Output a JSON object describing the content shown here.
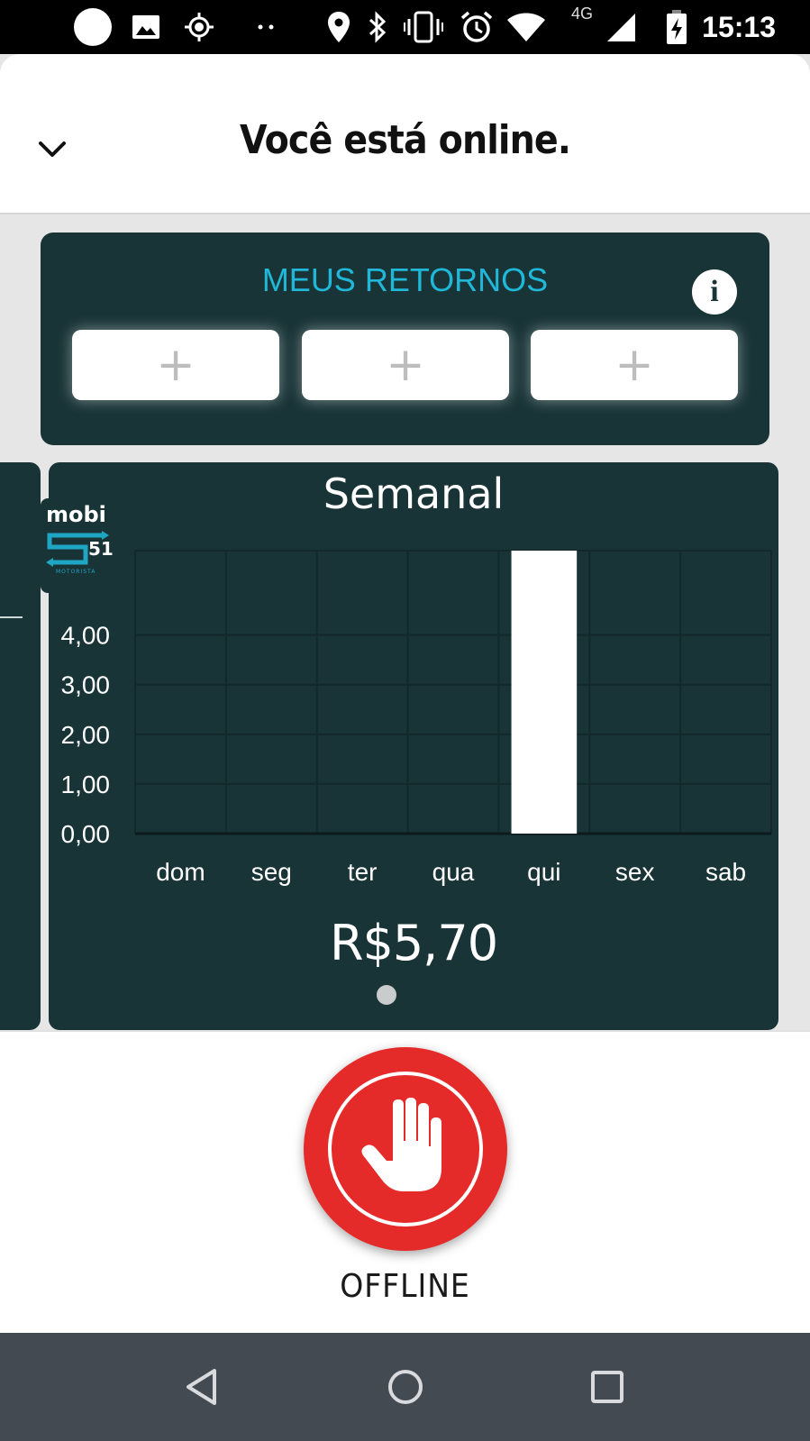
{
  "status_bar": {
    "network": "4G",
    "time": "15:13",
    "icons": [
      "circle-icon",
      "image-icon",
      "gps-icon",
      "more-dots-icon",
      "location-icon",
      "bluetooth-icon",
      "vibrate-icon",
      "alarm-icon",
      "wifi-icon",
      "signal-icon",
      "battery-charging-icon"
    ]
  },
  "header": {
    "title": "Você está online.",
    "collapse_icon": "chevron-down-icon"
  },
  "returns": {
    "title": "MEUS RETORNOS",
    "info_glyph": "i",
    "slots": [
      "+",
      "+",
      "+"
    ]
  },
  "logo": {
    "brand": "mobi",
    "number": "51",
    "subtitle": "MOTORISTA"
  },
  "chart_data": {
    "type": "bar",
    "title": "Semanal",
    "categories": [
      "dom",
      "seg",
      "ter",
      "qua",
      "qui",
      "sex",
      "sab"
    ],
    "values": [
      0,
      0,
      0,
      0,
      5.7,
      0,
      0
    ],
    "ytick_labels": [
      "0,00",
      "1,00",
      "2,00",
      "3,00",
      "4,00"
    ],
    "ylim": [
      0,
      5.7
    ],
    "grid": true,
    "bar_color": "#ffffff",
    "background": "#183437"
  },
  "total": "R$5,70",
  "offline": {
    "label": "OFFLINE",
    "color": "#e52a2a",
    "icon": "hand-stop-icon"
  },
  "nav": {
    "icons": [
      "back-triangle-icon",
      "home-circle-icon",
      "recents-square-icon"
    ]
  }
}
